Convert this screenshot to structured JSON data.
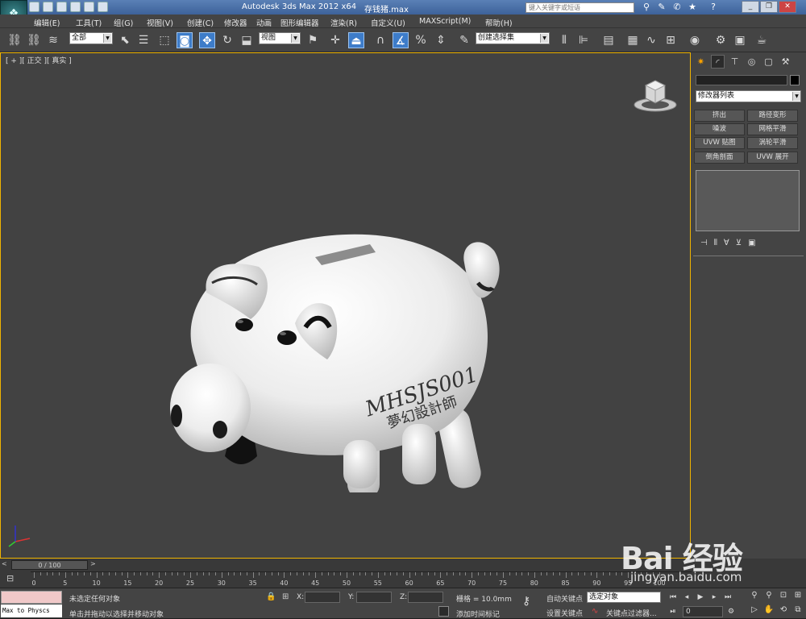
{
  "title_bar": {
    "app_title": "Autodesk 3ds Max  2012 x64",
    "file_name": "存钱猪.max",
    "search_placeholder": "键入关键字或短语"
  },
  "menu": [
    "编辑(E)",
    "工具(T)",
    "组(G)",
    "视图(V)",
    "创建(C)",
    "修改器",
    "动画",
    "图形编辑器",
    "渲染(R)",
    "自定义(U)",
    "MAXScript(M)",
    "帮助(H)"
  ],
  "toolbar": {
    "selection_filter": "全部",
    "reference_coord": "视图",
    "named_selection": "创建选择集"
  },
  "viewport": {
    "label": "[ + ][ 正交 ][ 真实 ]",
    "model_text_line1": "MHSJS001",
    "model_text_line2": "夢幻設計師"
  },
  "command_panel": {
    "modifier_list": "修改器列表",
    "modifier_buttons": [
      "挤出",
      "路径变形",
      "噪波",
      "网格平滑",
      "UVW 贴图",
      "涡轮平滑",
      "倒角剖面",
      "UVW 展开"
    ]
  },
  "timeline": {
    "slider": "0 / 100",
    "prev": "<",
    "next": ">",
    "ticks": [
      0,
      5,
      10,
      15,
      20,
      25,
      30,
      35,
      40,
      45,
      50,
      55,
      60,
      65,
      70,
      75,
      80,
      85,
      90,
      95,
      100
    ]
  },
  "status": {
    "maxscript_output": "Max to Physcs",
    "selection": "未选定任何对象",
    "prompt": "单击并拖动以选择并移动对象",
    "x_label": "X:",
    "y_label": "Y:",
    "z_label": "Z:",
    "grid": "栅格 = 10.0mm",
    "add_time_tag": "添加时间标记",
    "auto_key": "自动关键点",
    "set_key": "设置关键点",
    "key_mode": "选定对象",
    "key_filters": "关键点过滤器...",
    "frame": "0"
  },
  "watermark": {
    "logo": "Bai  经验",
    "url": "jingyan.baidu.com"
  }
}
